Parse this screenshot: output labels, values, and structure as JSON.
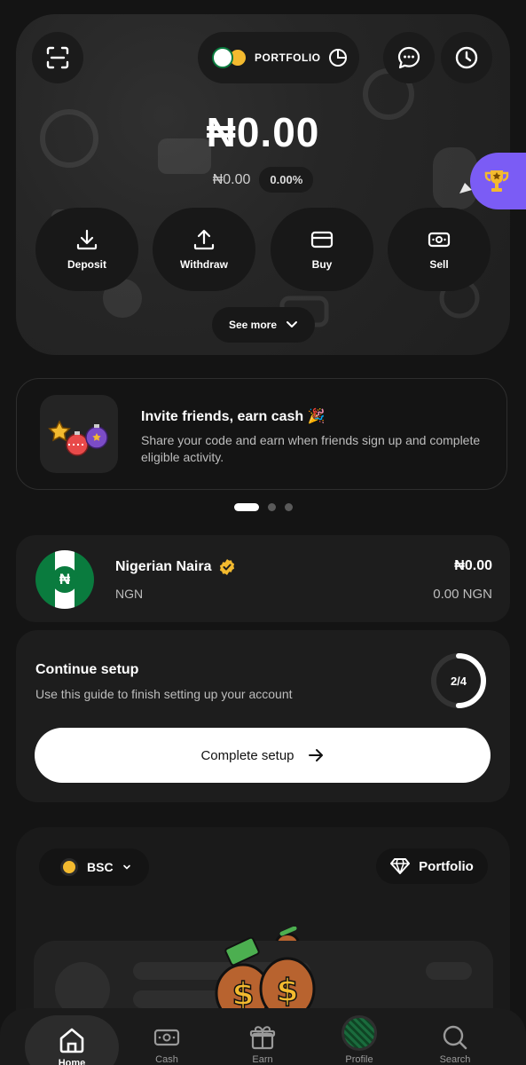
{
  "header": {
    "portfolio_label": "PORTFOLIO"
  },
  "balance": {
    "main": "₦0.00",
    "sub": "₦0.00",
    "change": "0.00%"
  },
  "actions": [
    {
      "label": "Deposit",
      "icon": "download-icon"
    },
    {
      "label": "Withdraw",
      "icon": "upload-icon"
    },
    {
      "label": "Buy",
      "icon": "card-icon"
    },
    {
      "label": "Sell",
      "icon": "cash-icon"
    }
  ],
  "see_more": "See more",
  "promo": {
    "title": "Invite friends, earn cash 🎉",
    "description": "Share your code and earn when friends sign up and complete eligible activity.",
    "carousel_total": 3,
    "carousel_active": 1
  },
  "currency": {
    "name": "Nigerian Naira",
    "code": "NGN",
    "value": "₦0.00",
    "value_native": "0.00 NGN",
    "symbol": "₦"
  },
  "setup": {
    "title": "Continue setup",
    "description": "Use this guide to finish setting up your account",
    "progress_text": "2/4",
    "progress": 0.5,
    "cta": "Complete setup"
  },
  "wallet": {
    "chain": "BSC",
    "portfolio_button": "Portfolio"
  },
  "tabs": [
    {
      "label": "Home",
      "icon": "home-icon",
      "active": true
    },
    {
      "label": "Cash",
      "icon": "cash-icon"
    },
    {
      "label": "Earn",
      "icon": "gift-icon"
    },
    {
      "label": "Profile",
      "icon": "avatar"
    },
    {
      "label": "Search",
      "icon": "search-icon"
    }
  ],
  "colors": {
    "background": "#141414",
    "accent_purple": "#7b5cf5",
    "naira_green": "#0a7b3e",
    "badge_gold": "#f3ba2f"
  }
}
